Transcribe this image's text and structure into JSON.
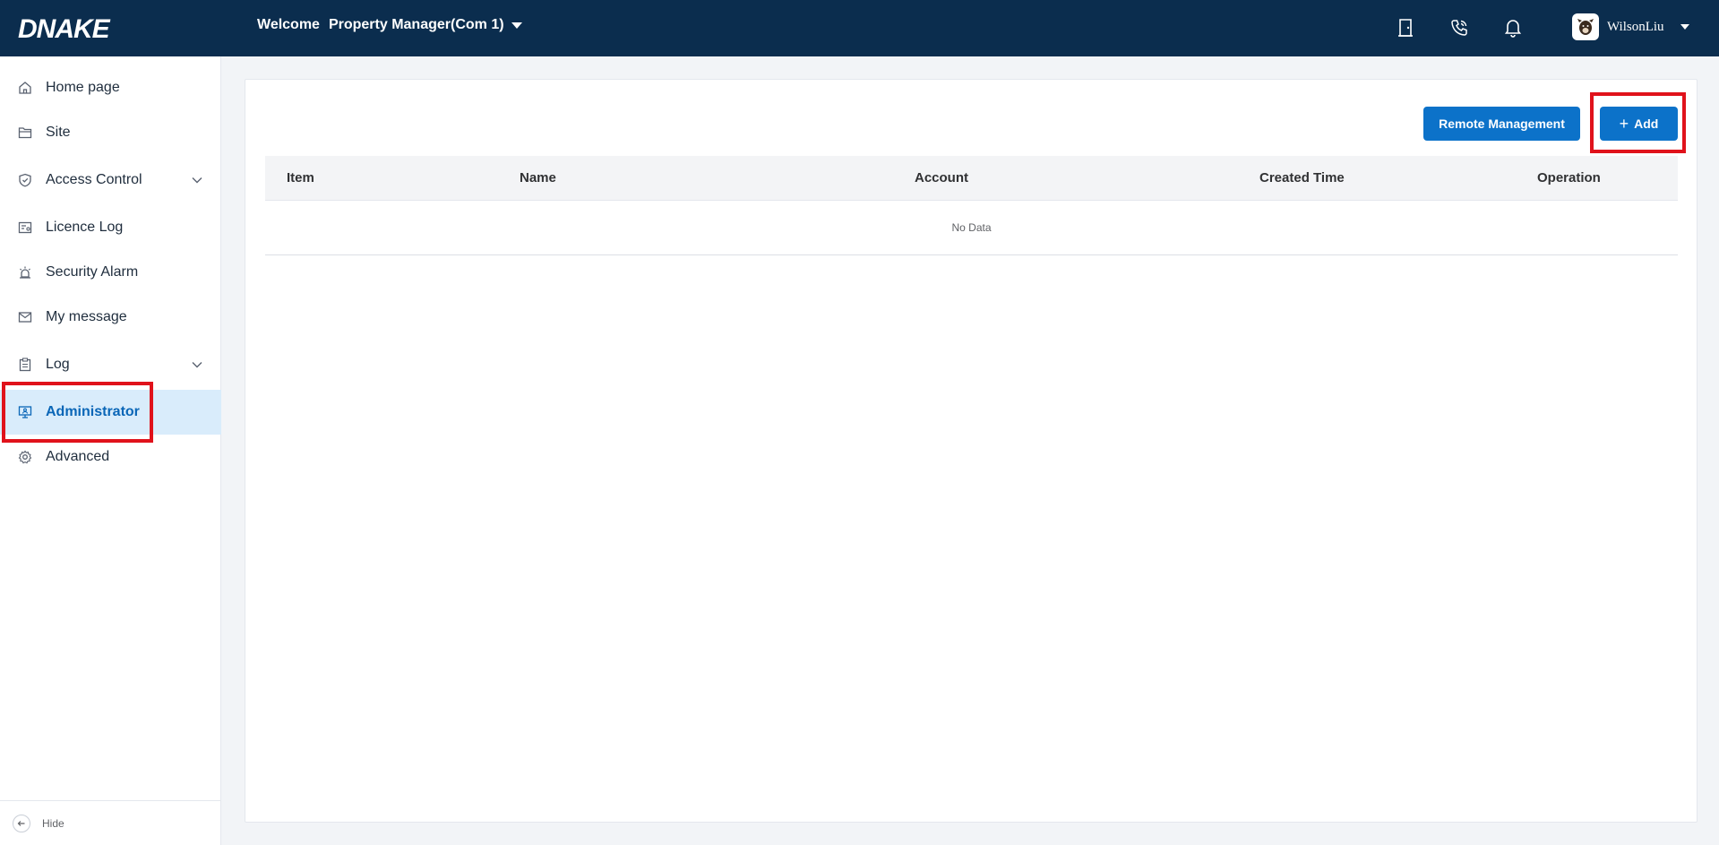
{
  "header": {
    "logo": "DNAKE",
    "welcome_label": "Welcome",
    "role": "Property Manager(Com 1)",
    "icons": [
      "door-icon",
      "phone-icon",
      "bell-icon"
    ],
    "user_name": "WilsonLiu"
  },
  "sidebar": {
    "items": [
      {
        "label": "Home page",
        "icon": "home-icon"
      },
      {
        "label": "Site",
        "icon": "folder-icon"
      },
      {
        "label": "Access Control",
        "icon": "shield-icon",
        "expandable": true
      },
      {
        "label": "Licence Log",
        "icon": "license-icon"
      },
      {
        "label": "Security Alarm",
        "icon": "alarm-icon"
      },
      {
        "label": "My message",
        "icon": "mail-icon"
      },
      {
        "label": "Log",
        "icon": "clipboard-icon",
        "expandable": true
      },
      {
        "label": "Administrator",
        "icon": "monitor-icon",
        "active": true
      },
      {
        "label": "Advanced",
        "icon": "gear-icon"
      }
    ],
    "hide_label": "Hide"
  },
  "toolbar": {
    "remote_label": "Remote Management",
    "add_label": "Add"
  },
  "table": {
    "columns": [
      "Item",
      "Name",
      "Account",
      "Created Time",
      "Operation"
    ],
    "empty_text": "No Data"
  },
  "colors": {
    "header_bg": "#0b2d4e",
    "accent": "#0c72c9",
    "active_bg": "#d9ecfb",
    "highlight": "#e0121b"
  }
}
